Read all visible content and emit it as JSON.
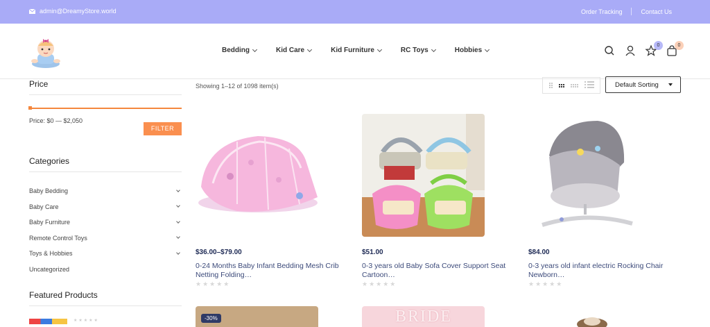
{
  "topbar": {
    "email": "admin@DreamyStore.world",
    "order_tracking": "Order Tracking",
    "contact_us": "Contact Us"
  },
  "nav": {
    "items": [
      {
        "label": "Bedding"
      },
      {
        "label": "Kid Care"
      },
      {
        "label": "Kid Furniture"
      },
      {
        "label": "RC Toys"
      },
      {
        "label": "Hobbies"
      }
    ],
    "wishlist_count": "0",
    "cart_count": "0"
  },
  "sidebar": {
    "price_heading": "Price",
    "price_range": "Price: $0 — $2,050",
    "filter_button": "FILTER",
    "categories_heading": "Categories",
    "categories": [
      {
        "label": "Baby Bedding",
        "expandable": true
      },
      {
        "label": "Baby Care",
        "expandable": true
      },
      {
        "label": "Baby Furniture",
        "expandable": true
      },
      {
        "label": "Remote Control Toys",
        "expandable": true
      },
      {
        "label": "Toys & Hobbies",
        "expandable": true
      },
      {
        "label": "Uncategorized",
        "expandable": false
      }
    ],
    "featured_heading": "Featured Products"
  },
  "toolbar": {
    "showing": "Showing 1–12 of 1098 item(s)",
    "sort_label": "Default Sorting"
  },
  "products": [
    {
      "price": "$36.00–$79.00",
      "title": "0-24 Months Baby Infant Bedding Mesh Crib Netting Folding…"
    },
    {
      "price": "$51.00",
      "title": "0-3 years old Baby Sofa Cover Support Seat Cartoon…"
    },
    {
      "price": "$84.00",
      "title": "0-3 years old infant electric Rocking Chair Newborn…"
    }
  ],
  "row2": {
    "discount_badge": "-30%",
    "bride_text": "BRIDE"
  },
  "colors": {
    "topbar": "#a9abf7",
    "accent": "#fa8f4f",
    "price_text": "#1e2a55"
  }
}
